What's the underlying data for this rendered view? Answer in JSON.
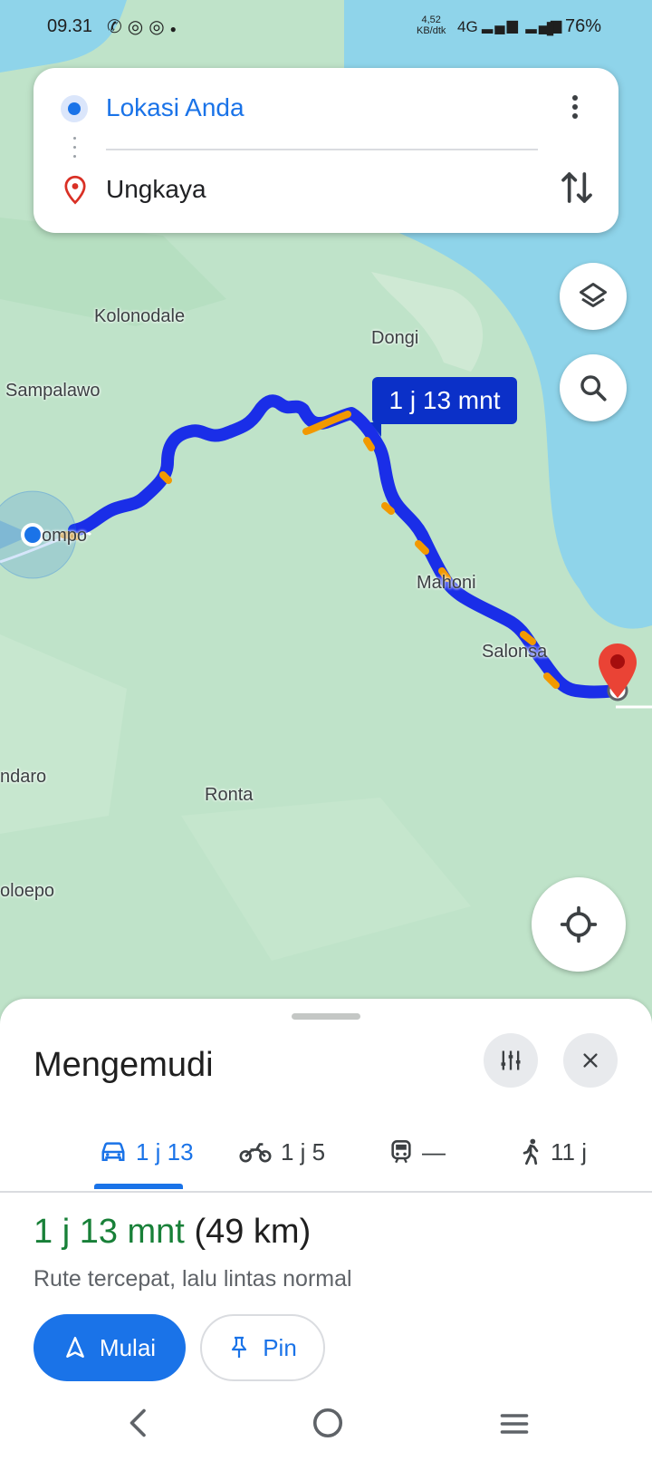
{
  "status_bar": {
    "time": "09.31",
    "speed_value": "4,52",
    "speed_unit": "KB/dtk",
    "network": "4G",
    "battery": "76%"
  },
  "directions": {
    "origin": "Lokasi Anda",
    "destination": "Ungkaya"
  },
  "map": {
    "eta_bubble": "1 j 13 mnt",
    "labels": {
      "kolonodale": "Kolonodale",
      "dongi": "Dongi",
      "sampalawo": "Sampalawo",
      "bompo": "ompo",
      "mahoni": "Mahoni",
      "salonsa": "Salonsa",
      "ndaro": "ndaro",
      "ronta": "Ronta",
      "oloepo": "oloepo"
    },
    "colors": {
      "route": "#1a2ee8",
      "traffic_slow": "#f29900",
      "water": "#8fd4ea",
      "land": "#bfe3c9",
      "destination_pin": "#ea4335"
    }
  },
  "sheet": {
    "title": "Mengemudi",
    "tabs": [
      {
        "icon": "car-icon",
        "label": "1 j 13"
      },
      {
        "icon": "motorcycle-icon",
        "label": "1 j 5"
      },
      {
        "icon": "train-icon",
        "label": "—"
      },
      {
        "icon": "walk-icon",
        "label": "11 j"
      }
    ],
    "duration": "1 j 13 mnt",
    "distance": "(49 km)",
    "summary": "Rute tercepat, lalu lintas normal",
    "start_label": "Mulai",
    "pin_label": "Pin",
    "accent": "#1a73e8",
    "duration_color": "#188038"
  }
}
